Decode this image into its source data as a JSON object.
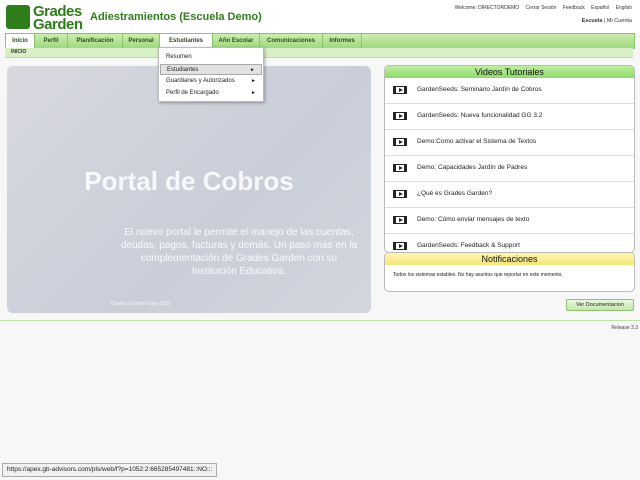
{
  "logo": {
    "line1": "Grades",
    "line2": "Garden"
  },
  "app_title": "Adiestramientos (Escuela Demo)",
  "toplinks": [
    "Welcome: DIRECTORDEMO",
    "Cerrar Sesión",
    "Feedback",
    "Español",
    "English"
  ],
  "context": {
    "school": "Escuela",
    "separator": "|",
    "account": "Mi Cuenta"
  },
  "tabs": [
    {
      "label": "Inicio"
    },
    {
      "label": "Perfil"
    },
    {
      "label": "Planificación"
    },
    {
      "label": "Personal"
    },
    {
      "label": "Estudiantes"
    },
    {
      "label": "Año Escolar"
    },
    {
      "label": "Comunicaciones"
    },
    {
      "label": "Informes"
    }
  ],
  "subtab": "INICIO",
  "dropdown": {
    "items": [
      {
        "label": "Resumen",
        "arrow": ""
      },
      {
        "label": "Estudiantes",
        "arrow": "►"
      },
      {
        "label": "Guardianes y Autorizados",
        "arrow": "►"
      },
      {
        "label": "Perfil de Encargado",
        "arrow": "►"
      }
    ]
  },
  "banner": {
    "title": "Portal de Cobros",
    "text": "El nuevo portal le permite el manejo de las cuentas, deudas, pagos, facturas y demás. Un paso más en la complementación de Grades Garden con su Institución Educativa.",
    "foot": "Grades Garden Copy 2016"
  },
  "videos": {
    "title": "Videos Tutoriales",
    "items": [
      "GardenSeeds: Seminario Jardín de Cobros",
      "GardenSeeds: Nueva funcionalidad GG 3.2",
      "Demo:Como activar el Sistema de Textos",
      "Demo: Capacidades Jardín de Padres",
      "¿Qué es Grades Garden?",
      "Demo: Cómo enviar mensajes de texto",
      "GardenSeeds: Feedback & Support"
    ]
  },
  "notifications": {
    "title": "Notificaciones",
    "text": "Todos los sistemas estables. No hay asuntos que reportar en este momento."
  },
  "doc_button": "Ver Documentacion",
  "release": "Release 3.3",
  "status_url": "https://apex.gb-advisors.com/pls/web/f?p=1052:2:665285497481::NO:::"
}
